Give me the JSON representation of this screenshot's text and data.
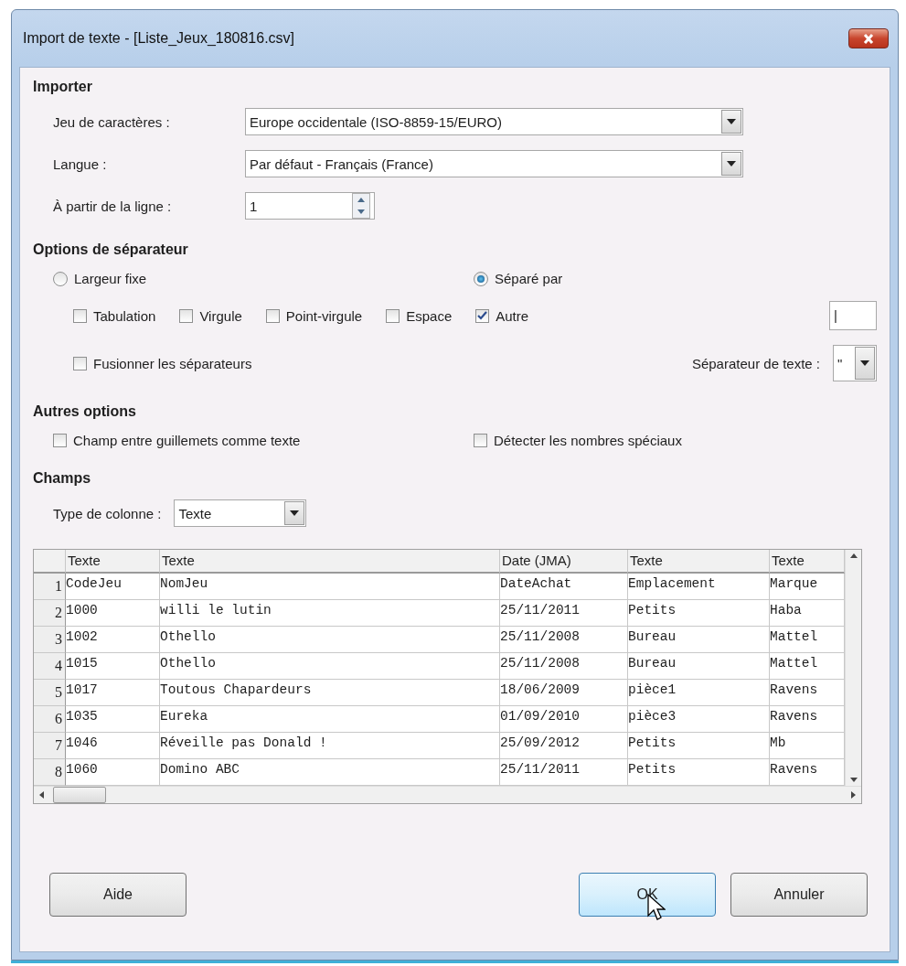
{
  "window": {
    "title": "Import de texte - [Liste_Jeux_180816.csv]"
  },
  "import": {
    "heading": "Importer",
    "charset": {
      "label": "Jeu de caractères :",
      "value": "Europe occidentale (ISO-8859-15/EURO)"
    },
    "language": {
      "label": "Langue :",
      "value": "Par défaut - Français (France)"
    },
    "from_line": {
      "label": "À partir de la ligne :",
      "value": "1"
    }
  },
  "separator_options": {
    "heading": "Options de séparateur",
    "modes": [
      {
        "label": "Largeur fixe",
        "selected": false
      },
      {
        "label": "Séparé par",
        "selected": true
      }
    ],
    "separators": [
      {
        "label": "Tabulation",
        "checked": false
      },
      {
        "label": "Virgule",
        "checked": false
      },
      {
        "label": "Point-virgule",
        "checked": false
      },
      {
        "label": "Espace",
        "checked": false
      },
      {
        "label": "Autre",
        "checked": true
      }
    ],
    "other_value": "|",
    "merge": {
      "label": "Fusionner les séparateurs",
      "checked": false
    },
    "text_separator": {
      "label": "Séparateur de texte :",
      "value": "\""
    }
  },
  "other_options": {
    "heading": "Autres options",
    "items": [
      {
        "label": "Champ entre guillemets comme texte",
        "checked": false
      },
      {
        "label": "Détecter les nombres spéciaux",
        "checked": false
      }
    ]
  },
  "fields": {
    "heading": "Champs",
    "column_type": {
      "label": "Type de colonne :",
      "value": "Texte"
    },
    "table": {
      "columns": [
        "Texte",
        "Texte",
        "Date (JMA)",
        "Texte",
        "Texte"
      ],
      "rows": [
        {
          "number": "1",
          "cells": [
            "CodeJeu",
            "NomJeu",
            "DateAchat",
            "Emplacement",
            "Marque"
          ]
        },
        {
          "number": "2",
          "cells": [
            "1000",
            "willi le lutin",
            "25/11/2011",
            "Petits",
            "Haba"
          ]
        },
        {
          "number": "3",
          "cells": [
            "1002",
            "Othello",
            "25/11/2008",
            "Bureau",
            "Mattel"
          ]
        },
        {
          "number": "4",
          "cells": [
            "1015",
            "Othello",
            "25/11/2008",
            "Bureau",
            "Mattel"
          ]
        },
        {
          "number": "5",
          "cells": [
            "1017",
            "Toutous Chapardeurs",
            "18/06/2009",
            "pièce1",
            "Ravens"
          ]
        },
        {
          "number": "6",
          "cells": [
            "1035",
            "Eureka",
            "01/09/2010",
            "pièce3",
            "Ravens"
          ]
        },
        {
          "number": "7",
          "cells": [
            "1046",
            "Réveille pas Donald !",
            "25/09/2012",
            "Petits",
            "Mb"
          ]
        },
        {
          "number": "8",
          "cells": [
            "1060",
            "Domino ABC",
            "25/11/2011",
            "Petits",
            "Ravens"
          ]
        }
      ]
    }
  },
  "buttons": [
    {
      "label": "Aide",
      "hovered": false
    },
    {
      "label": "OK",
      "hovered": true
    },
    {
      "label": "Annuler",
      "hovered": false
    }
  ]
}
